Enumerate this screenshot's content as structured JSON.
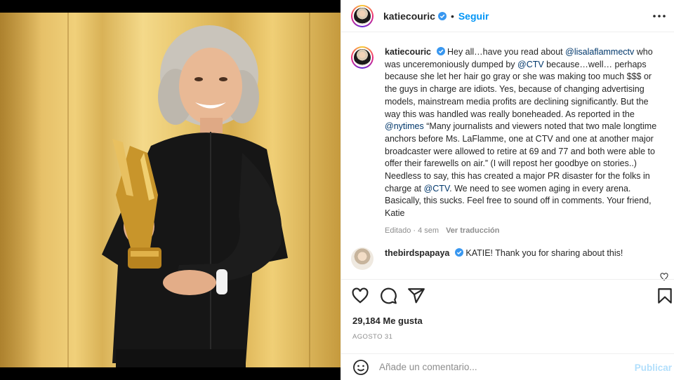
{
  "header": {
    "username": "katiecouric",
    "follow_label": "Seguir"
  },
  "caption": {
    "username": "katiecouric",
    "segments": [
      " Hey all…have you read about ",
      "@lisalaflammectv",
      " who was unceremoniously dumped by ",
      "@CTV",
      " because…well… perhaps because she let her hair go gray or she was making too much $$$ or the guys in charge are idiots. Yes, because of changing advertising models, mainstream media profits are declining significantly. But the way this was handled was really boneheaded. As reported in the ",
      "@nytimes",
      " “Many journalists and viewers noted that two male longtime anchors before Ms. LaFlamme, one at CTV and one at another major broadcaster were allowed to retire at 69 and 77 and both were able to offer their farewells on air.” (I will repost her goodbye on stories..) Needless to say, this has created a major PR disaster for the folks in charge at ",
      "@CTV",
      ". We need to see women aging in every arena. Basically, this sucks. Feel free to sound off in comments. Your friend, Katie"
    ],
    "edited_label": "Editado",
    "time_ago": "4 sem",
    "translate_label": "Ver traducción"
  },
  "reply": {
    "username": "thebirdspapaya",
    "text": "KATIE! Thank you for sharing about this!"
  },
  "stats": {
    "likes": "29,184 Me gusta",
    "date": "AGOSTO 31"
  },
  "comment_box": {
    "placeholder": "Añade un comentario...",
    "publish_label": "Publicar"
  },
  "colors": {
    "link": "#0095f6",
    "mention": "#00376b",
    "muted": "#8e8e8e",
    "verified": "#3897f0"
  },
  "icons": [
    "verified-badge-icon",
    "more-options-icon",
    "heart-icon",
    "comment-icon",
    "share-icon",
    "bookmark-icon",
    "smiley-icon"
  ]
}
